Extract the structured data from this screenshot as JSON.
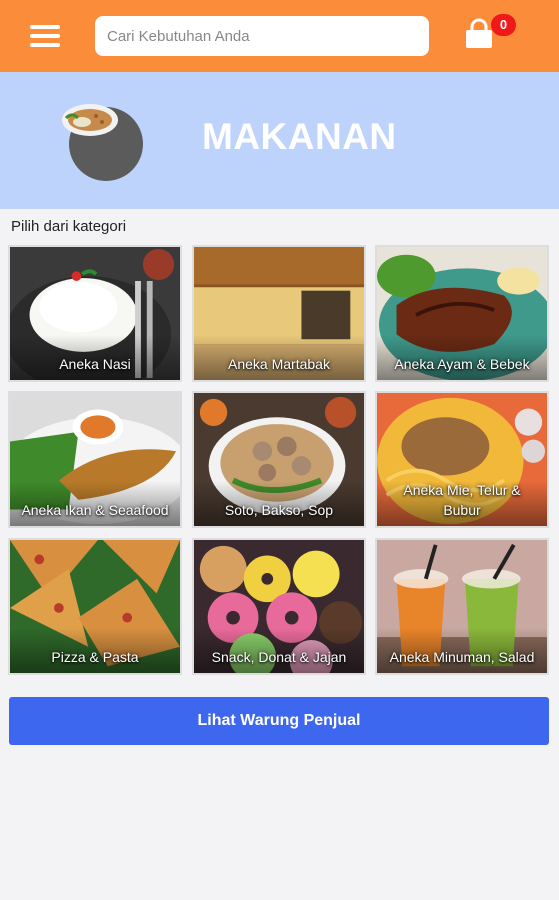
{
  "header": {
    "search_placeholder": "Cari Kebutuhan Anda",
    "cart_count": "0"
  },
  "banner": {
    "title": "MAKANAN"
  },
  "section_label": "Pilih dari kategori",
  "categories": [
    {
      "label": "Aneka Nasi"
    },
    {
      "label": "Aneka Martabak"
    },
    {
      "label": "Aneka Ayam & Bebek"
    },
    {
      "label": "Aneka Ikan & Seaafood"
    },
    {
      "label": "Soto, Bakso, Sop"
    },
    {
      "label": "Aneka Mie, Telur & Bubur"
    },
    {
      "label": "Pizza & Pasta"
    },
    {
      "label": "Snack, Donat & Jajan"
    },
    {
      "label": "Aneka Minuman, Salad"
    }
  ],
  "cta_label": "Lihat Warung Penjual",
  "colors": {
    "header": "#fb8c3a",
    "banner": "#bdd3fb",
    "cta": "#3e67ef",
    "badge": "#f01818"
  },
  "icons": [
    "menu-icon",
    "shopping-bag-icon",
    "food-bowl-icon"
  ]
}
